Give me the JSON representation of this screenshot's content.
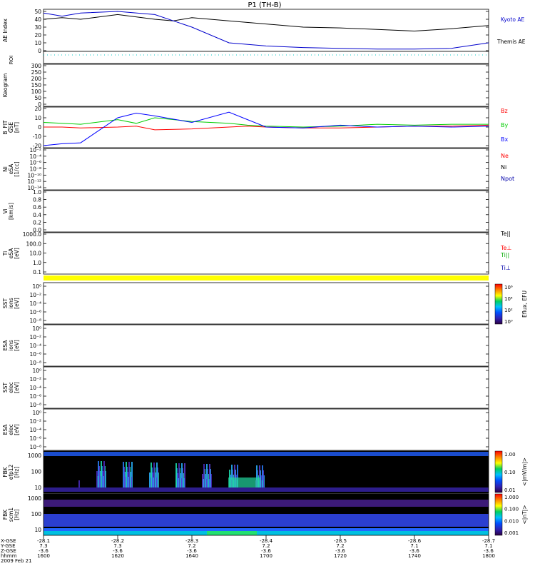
{
  "title": "P1  (TH-B)",
  "colors": {
    "kyoto": "#000000",
    "themis": "#0000cc",
    "bz": "#ff0000",
    "by": "#00cc00",
    "bx": "#0000ff",
    "roi": "#00c8c8",
    "yellow": "#ffff00",
    "spec_bg": "#000000",
    "spec_band": "#1a4ccc"
  },
  "panels": {
    "ae": {
      "ylabel": "AE Index",
      "ticks": [
        "50",
        "40",
        "30",
        "20",
        "10",
        "0"
      ],
      "legend": [
        "Kyoto AE",
        "Themis AE"
      ]
    },
    "roi": {
      "ylabel": "ROI"
    },
    "keogram": {
      "ylabel": "Keogram",
      "ticks": [
        "300",
        "250",
        "200",
        "150",
        "100",
        "50",
        "0"
      ]
    },
    "bfield": {
      "ylabel": [
        "B_FIT",
        "GSE",
        "[nT]"
      ],
      "ticks": [
        "20",
        "10",
        "0",
        "-10",
        "-20"
      ],
      "legend": [
        "Bz",
        "By",
        "Bx"
      ]
    },
    "ni": {
      "ylabel": [
        "Ni",
        "eSA",
        "[1/cc]"
      ],
      "ticks": [
        "10⁻²",
        "10⁻⁴",
        "10⁻⁶",
        "10⁻⁸",
        "10⁻¹⁰",
        "10⁻¹²",
        "10⁻¹⁴"
      ],
      "legend": [
        "Ne",
        "Ni",
        "Npot"
      ]
    },
    "vi": {
      "ylabel": [
        "Vi",
        "[km/s]"
      ],
      "ticks": [
        "1.0",
        "0.8",
        "0.6",
        "0.4",
        "0.2",
        "0.0"
      ]
    },
    "ti": {
      "ylabel": [
        "Ti",
        "eSA",
        "[eV]"
      ],
      "ticks": [
        "1000.0",
        "100.0",
        "10.0",
        "1.0",
        "0.1"
      ],
      "legend": [
        "Te||",
        "Te⊥",
        "Ti||",
        "Ti⊥"
      ]
    },
    "sst_i": {
      "ylabel": [
        "SST",
        "ions",
        "[eV]"
      ],
      "ticks": [
        "10⁰",
        "10⁻²",
        "10⁻⁴",
        "10⁻⁶",
        "10⁻⁸"
      ]
    },
    "esa_i": {
      "ylabel": [
        "ESA",
        "ions",
        "[eV]"
      ],
      "ticks": [
        "10⁰",
        "10⁻²",
        "10⁻⁴",
        "10⁻⁶",
        "10⁻⁸"
      ]
    },
    "sst_e": {
      "ylabel": [
        "SST",
        "elec",
        "[eV]"
      ],
      "ticks": [
        "10⁰",
        "10⁻²",
        "10⁻⁴",
        "10⁻⁶",
        "10⁻⁸"
      ]
    },
    "esa_e": {
      "ylabel": [
        "ESA",
        "elec",
        "[eV]"
      ],
      "ticks": [
        "10⁰",
        "10⁻²",
        "10⁻⁴",
        "10⁻⁶",
        "10⁻⁸"
      ]
    },
    "fbk1": {
      "ylabel": [
        "FBK",
        "efp12",
        "[Hz]"
      ],
      "ticks": [
        "1000",
        "100",
        "10"
      ]
    },
    "fbk2": {
      "ylabel": [
        "FBK",
        "scm1",
        "[Hz]"
      ],
      "ticks": [
        "1000",
        "100",
        "10"
      ]
    }
  },
  "colorbars": {
    "eflux": {
      "label": "Eflux, EFU",
      "ticks": [
        "10⁶",
        "10⁴",
        "10²",
        "10⁰"
      ]
    },
    "fbk1": {
      "label": "<|mV/m|>",
      "ticks": [
        "1.00",
        "0.10",
        "0.01"
      ]
    },
    "fbk2": {
      "label": "<|nT|>",
      "ticks": [
        "1.000",
        "0.100",
        "0.010",
        "0.001"
      ]
    }
  },
  "xaxis": {
    "row_labels": [
      "X-GSE",
      "Y-GSE",
      "Z-GSE",
      "hhmm",
      "2009 Feb 21"
    ],
    "columns": [
      {
        "x": "-28.1",
        "y": "7.3",
        "z": "-3.6",
        "t": "1600"
      },
      {
        "x": "-28.2",
        "y": "7.3",
        "z": "-3.6",
        "t": "1620"
      },
      {
        "x": "-28.3",
        "y": "7.2",
        "z": "-3.6",
        "t": "1640"
      },
      {
        "x": "-28.4",
        "y": "7.2",
        "z": "-3.6",
        "t": "1700"
      },
      {
        "x": "-28.5",
        "y": "7.2",
        "z": "-3.6",
        "t": "1720"
      },
      {
        "x": "-28.6",
        "y": "7.1",
        "z": "-3.6",
        "t": "1740"
      },
      {
        "x": "-28.7",
        "y": "7.1",
        "z": "-3.6",
        "t": "1800"
      }
    ]
  },
  "chart_data": [
    {
      "type": "line",
      "title": "P1  (TH-B)",
      "ylabel": "AE Index",
      "ylim": [
        0,
        50
      ],
      "x": [
        0,
        5,
        10,
        20,
        30,
        35,
        40,
        50,
        60,
        70,
        80,
        90,
        100,
        110,
        120
      ],
      "series": [
        {
          "name": "Kyoto AE",
          "values": [
            40,
            42,
            40,
            46,
            40,
            38,
            42,
            38,
            34,
            30,
            29,
            27,
            25,
            28,
            32
          ]
        },
        {
          "name": "Themis AE",
          "values": [
            48,
            44,
            48,
            50,
            46,
            38,
            30,
            10,
            6,
            4,
            3,
            2,
            2,
            3,
            10
          ]
        }
      ]
    },
    {
      "type": "line",
      "ylabel": "B_FIT GSE [nT]",
      "ylim": [
        -20,
        20
      ],
      "x": [
        0,
        5,
        10,
        20,
        25,
        30,
        40,
        50,
        55,
        60,
        70,
        80,
        90,
        100,
        110,
        120
      ],
      "series": [
        {
          "name": "Bz",
          "values": [
            0,
            0,
            -1,
            0,
            1,
            -3,
            -2,
            0,
            1,
            0,
            -1,
            -1,
            0,
            1,
            1,
            2
          ]
        },
        {
          "name": "By",
          "values": [
            5,
            4,
            3,
            8,
            4,
            10,
            6,
            4,
            2,
            1,
            0,
            1,
            3,
            2,
            3,
            3
          ]
        },
        {
          "name": "Bx",
          "values": [
            -20,
            -18,
            -17,
            10,
            15,
            12,
            5,
            16,
            8,
            0,
            -1,
            2,
            0,
            1,
            0,
            1
          ]
        }
      ]
    }
  ]
}
